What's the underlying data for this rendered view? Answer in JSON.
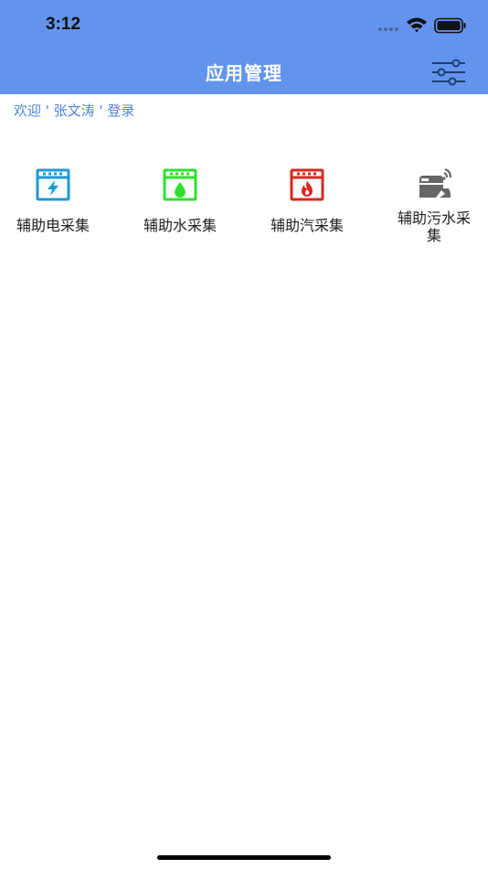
{
  "status_bar": {
    "time": "3:12"
  },
  "nav": {
    "title": "应用管理"
  },
  "welcome_text": "欢迎 ' 张文涛 ' 登录",
  "modules": [
    {
      "label": "辅助电采集",
      "icon": "electric-meter-icon",
      "color": "#1e9ad6"
    },
    {
      "label": "辅助水采集",
      "icon": "water-meter-icon",
      "color": "#2ee02e"
    },
    {
      "label": "辅助汽采集",
      "icon": "steam-meter-icon",
      "color": "#d42b1e"
    },
    {
      "label": "辅助污水采集",
      "icon": "sewage-truck-icon",
      "color": "#666666"
    }
  ],
  "colors": {
    "header": "#6394ed",
    "welcome": "#4a86d9"
  }
}
